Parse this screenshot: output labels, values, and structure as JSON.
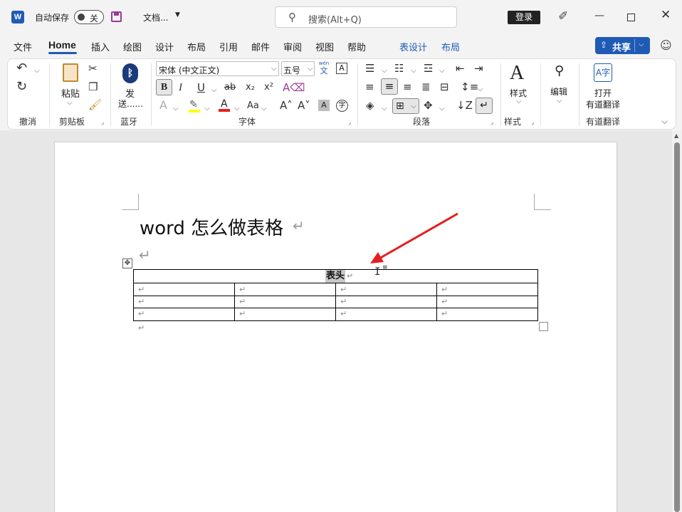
{
  "titlebar": {
    "autosave_label": "自动保存",
    "autosave_state": "关",
    "doc_name": "文档...",
    "search_placeholder": "搜索(Alt+Q)",
    "login_label": "登录"
  },
  "tabs": [
    "文件",
    "Home",
    "插入",
    "绘图",
    "设计",
    "布局",
    "引用",
    "邮件",
    "审阅",
    "视图",
    "帮助",
    "表设计",
    "布局"
  ],
  "share_label": "共享",
  "ribbon": {
    "groups": {
      "undo": "撤消",
      "clipboard": "剪贴板",
      "bluetooth": "蓝牙",
      "font": "字体",
      "paragraph": "段落",
      "styles": "样式",
      "youdao": "有道翻译"
    },
    "paste_label": "粘贴",
    "send_label_1": "发",
    "send_label_2": "送......",
    "font_name": "宋体 (中文正文)",
    "font_size": "五号",
    "styles_label": "样式",
    "edit_label": "编辑",
    "open_label": "打开",
    "youdao_label": "有道翻译",
    "wen_label": "wén",
    "wen_char": "文"
  },
  "document": {
    "heading": "word 怎么做表格",
    "table_header": "表头",
    "table_rows": 3,
    "table_cols": 4
  },
  "colors": {
    "accent": "#1f5bb5",
    "share_bg": "#1f5bb5",
    "arrow": "#e41e1e",
    "highlight": "#ffff00",
    "font_red": "#e41e1e"
  }
}
